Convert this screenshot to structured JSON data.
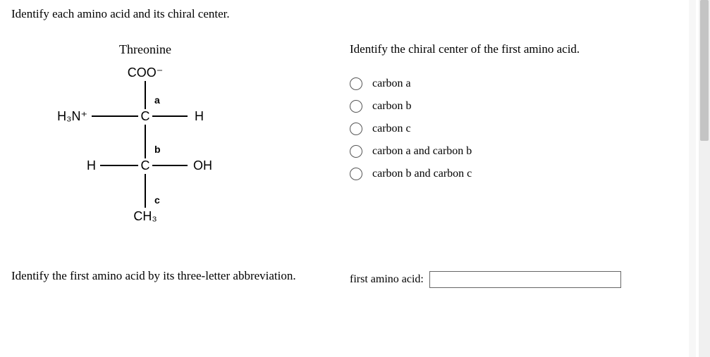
{
  "heading": "Identify each amino acid and its chiral center.",
  "molecule": {
    "title": "Threonine",
    "top": "COO⁻",
    "a_label": "a",
    "b_label": "b",
    "c_label": "c",
    "carbon": "C",
    "h": "H",
    "h3n": "H₃N⁺",
    "oh": "OH",
    "ch3": "CH₃"
  },
  "right": {
    "heading": "Identify the chiral center of the first amino acid.",
    "options": [
      "carbon a",
      "carbon b",
      "carbon c",
      "carbon a and carbon b",
      "carbon b and carbon c"
    ]
  },
  "bottom": {
    "left": "Identify the first amino acid by its three-letter abbreviation.",
    "right_label": "first amino acid:"
  }
}
